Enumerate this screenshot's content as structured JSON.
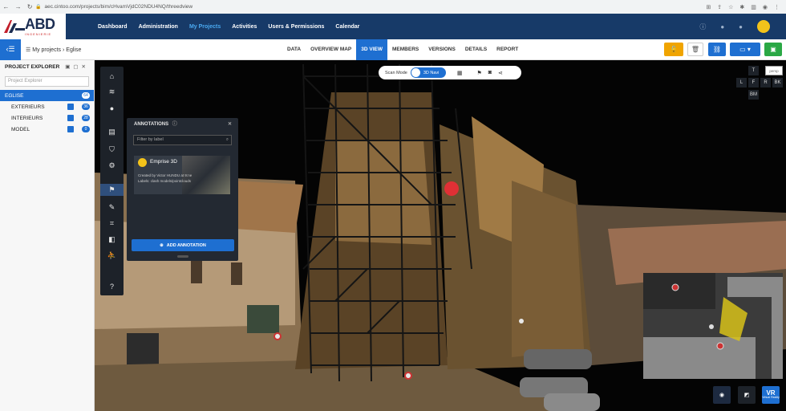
{
  "browser": {
    "url": "aec.cintoo.com/projects/bim/cHvamVjdC02NDU4NQ/threedview"
  },
  "header": {
    "logo_text": "ABD",
    "logo_sub": "INGENIERIE",
    "menu": [
      "Dashboard",
      "Administration",
      "My Projects",
      "Activities",
      "Users & Permissions",
      "Calendar"
    ]
  },
  "subbar": {
    "breadcrumb_root": "My projects",
    "breadcrumb_sep": "›",
    "breadcrumb_leaf": "Eglise",
    "tabs": [
      "DATA",
      "OVERVIEW MAP",
      "3D VIEW",
      "MEMBERS",
      "VERSIONS",
      "DETAILS",
      "REPORT"
    ]
  },
  "explorer": {
    "title": "PROJECT EXPLORER",
    "search_placeholder": "Project Explorer",
    "items": [
      {
        "label": "EGLISE",
        "count": "64"
      },
      {
        "label": "EXTERIEURS",
        "count": "36"
      },
      {
        "label": "INTERIEURS",
        "count": "28"
      },
      {
        "label": "MODEL",
        "count": "0"
      }
    ]
  },
  "annotations": {
    "title": "ANNOTATIONS",
    "filter_placeholder": "Filter by label",
    "card": {
      "name": "Emprise 3D",
      "created": "Created by Victor HUNDU at 9:ne",
      "labels": "Labels: clash models/pointclouds"
    },
    "add_label": "ADD ANNOTATION"
  },
  "scanbar": {
    "mode_label": "Scan Mode",
    "view_label": "3D Navi"
  },
  "viewcube": {
    "t": "T",
    "persp": "persp",
    "l": "L",
    "f": "F",
    "r": "R",
    "bk": "BK",
    "bm": "BM"
  },
  "vr": {
    "label1": "VR",
    "label2": "Virtual Reality"
  },
  "colors": {
    "primary": "#1e6fd1",
    "header": "#173a68",
    "warning": "#f0a400",
    "green": "#2aa845"
  }
}
